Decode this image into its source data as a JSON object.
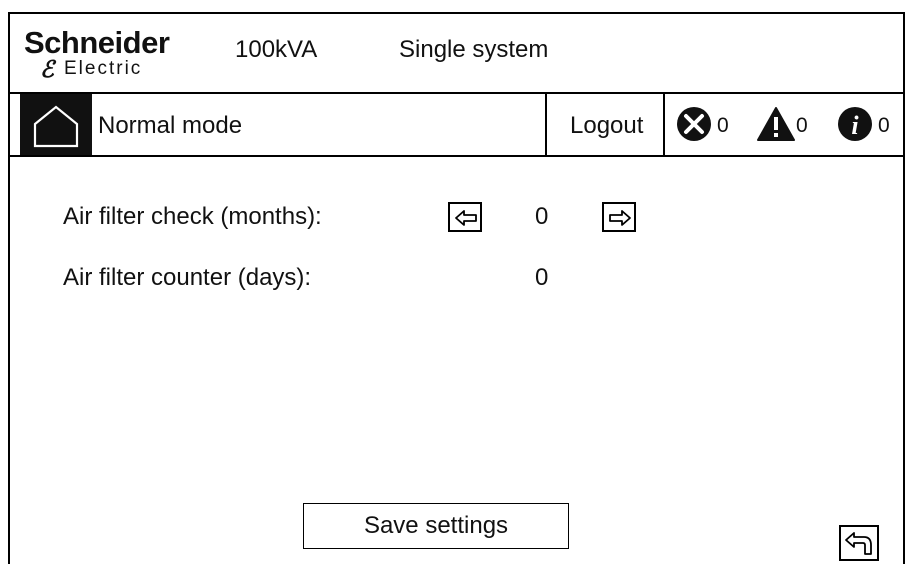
{
  "header": {
    "brand_top": "Schneider",
    "brand_bottom": "Electric",
    "power_rating": "100kVA",
    "system_type": "Single system"
  },
  "status_bar": {
    "mode": "Normal mode",
    "logout_label": "Logout",
    "alarm_count": "0",
    "warning_count": "0",
    "info_count": "0"
  },
  "settings": {
    "air_filter_check_label": "Air filter check (months):",
    "air_filter_check_value": "0",
    "air_filter_counter_label": "Air filter counter (days):",
    "air_filter_counter_value": "0"
  },
  "actions": {
    "save_label": "Save settings"
  },
  "icons": {
    "home": "home-icon",
    "alarm": "x-circle-icon",
    "warning": "warning-triangle-icon",
    "info": "info-circle-icon",
    "decrease": "arrow-left-icon",
    "increase": "arrow-right-icon",
    "back": "back-arrow-icon"
  },
  "colors": {
    "foreground": "#111111",
    "background": "#ffffff"
  }
}
